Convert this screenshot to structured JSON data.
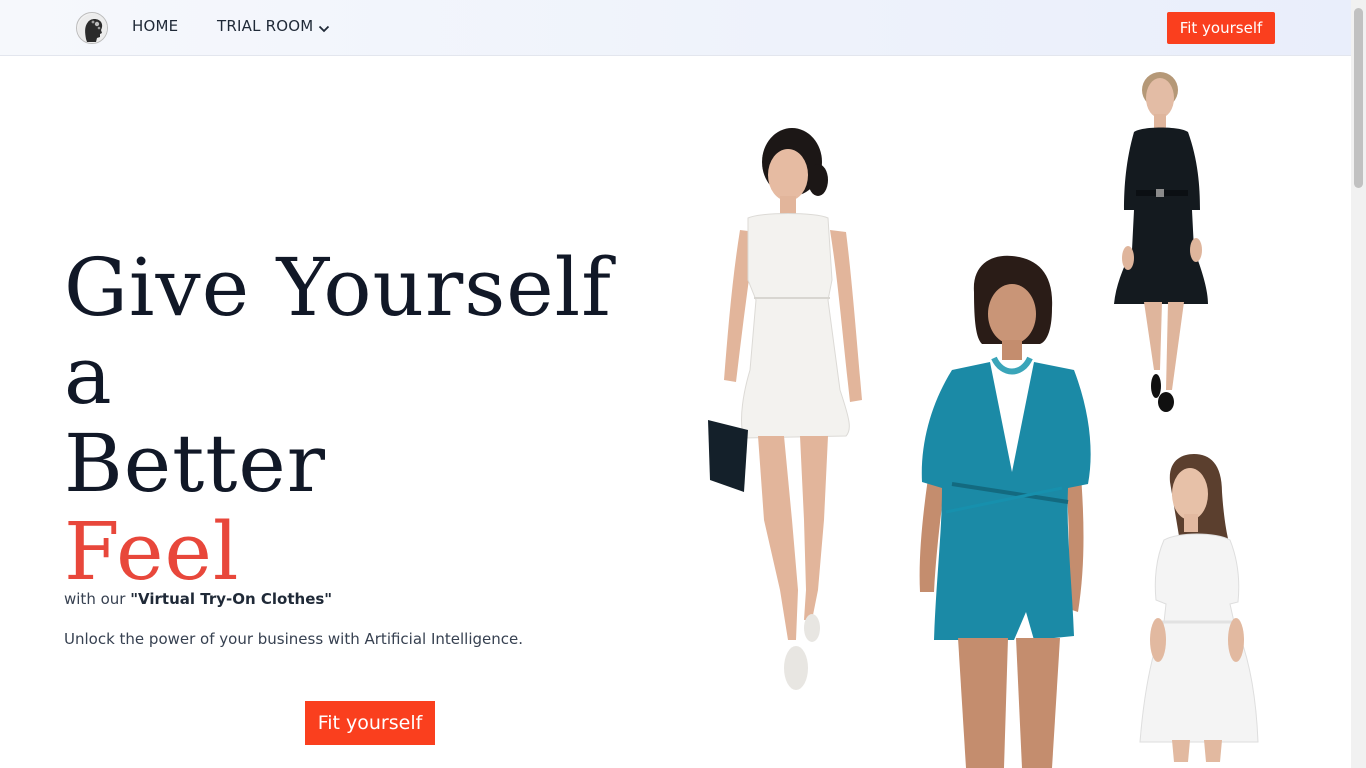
{
  "nav": {
    "logo_icon": "face-silhouette-logo-icon",
    "home": "HOME",
    "trial_room": "TRIAL ROOM",
    "trial_room_icon": "chevron-down-icon",
    "cta": "Fit yourself"
  },
  "hero": {
    "headline_line1": "Give Yourself a",
    "headline_line2": "Better",
    "headline_accent": "Feel",
    "sub_prefix": "with our ",
    "sub_bold": "\"Virtual Try-On Clothes\"",
    "tagline": "Unlock the power of your business with Artificial Intelligence.",
    "cta": "Fit yourself"
  },
  "models": [
    {
      "name": "model-white-sleeveless-dress",
      "dress_color": "#f3f2ef"
    },
    {
      "name": "model-teal-wrap-dress",
      "dress_color": "#1b8aa6"
    },
    {
      "name": "model-black-dress",
      "dress_color": "#141a1f"
    },
    {
      "name": "model-white-smock-dress",
      "dress_color": "#f4f4f4"
    }
  ],
  "colors": {
    "accent": "#fa3f1e",
    "headline_accent": "#e8473b",
    "headline": "#111827"
  }
}
